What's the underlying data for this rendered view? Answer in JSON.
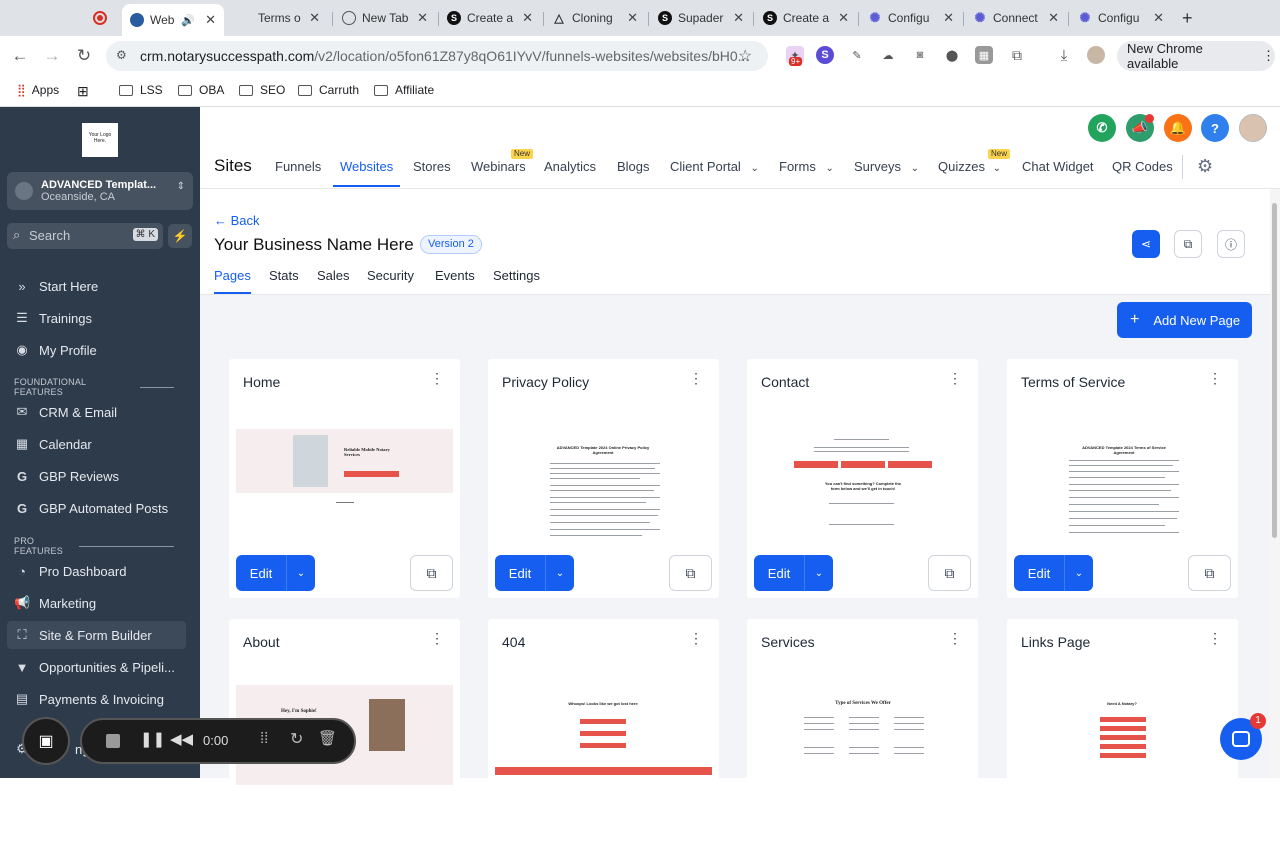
{
  "browser": {
    "tabs": [
      {
        "title": "Web",
        "active": true,
        "icon": "site-icon"
      },
      {
        "title": "Terms o",
        "icon": "page-icon"
      },
      {
        "title": "New Tab",
        "icon": "globe-icon"
      },
      {
        "title": "Create a",
        "icon": "s-icon"
      },
      {
        "title": "Cloning",
        "icon": "drive-icon"
      },
      {
        "title": "Supader",
        "icon": "s-icon"
      },
      {
        "title": "Create a",
        "icon": "s-icon"
      },
      {
        "title": "Configu",
        "icon": "star-icon"
      },
      {
        "title": "Connect",
        "icon": "star-icon"
      },
      {
        "title": "Configu",
        "icon": "star-icon"
      }
    ],
    "new_tab": "+",
    "url_domain": "crm.notarysuccesspath.com",
    "url_path": "/v2/location/o5fon61Z87y8qO61IYvV/funnels-websites/websites/bH0...",
    "ext_badge": "9+",
    "new_chrome": "New Chrome available",
    "bookmarks": [
      "Apps",
      "LSS",
      "OBA",
      "SEO",
      "Carruth",
      "Affiliate"
    ]
  },
  "sidebar": {
    "logo_text": "Your Logo Here.",
    "location_name": "ADVANCED Templat...",
    "location_city": "Oceanside, CA",
    "search_placeholder": "Search",
    "search_shortcut": "⌘ K",
    "items_top": [
      "Start Here",
      "Trainings",
      "My Profile"
    ],
    "section_foundational": "FOUNDATIONAL FEATURES",
    "items_foundational": [
      "CRM & Email",
      "Calendar",
      "GBP Reviews",
      "GBP Automated Posts"
    ],
    "section_pro": "PRO FEATURES",
    "items_pro": [
      "Pro Dashboard",
      "Marketing",
      "Site & Form Builder",
      "Opportunities & Pipeli...",
      "Payments & Invoicing"
    ],
    "settings_partial": "ngs"
  },
  "header": {
    "section_title": "Sites",
    "nav": [
      {
        "label": "Funnels"
      },
      {
        "label": "Websites",
        "active": true
      },
      {
        "label": "Stores"
      },
      {
        "label": "Webinars",
        "badge": "New"
      },
      {
        "label": "Analytics"
      },
      {
        "label": "Blogs"
      },
      {
        "label": "Client Portal",
        "dropdown": true
      },
      {
        "label": "Forms",
        "dropdown": true
      },
      {
        "label": "Surveys",
        "dropdown": true
      },
      {
        "label": "Quizzes",
        "dropdown": true,
        "badge": "New"
      },
      {
        "label": "Chat Widget"
      },
      {
        "label": "QR Codes"
      }
    ]
  },
  "page": {
    "back_label": "Back",
    "site_name": "Your Business Name Here",
    "version_badge": "Version 2",
    "tabs": [
      "Pages",
      "Stats",
      "Sales",
      "Security",
      "Events",
      "Settings"
    ],
    "add_page_label": "Add New Page",
    "edit_label": "Edit",
    "cards": [
      {
        "name": "Home",
        "thumb_heading": "Reliable Mobile Notary Services"
      },
      {
        "name": "Privacy Policy",
        "thumb_heading": "ADVANCED Template 2024 Online Privacy Policy Agreement"
      },
      {
        "name": "Contact",
        "thumb_heading": "You can't find something? Complete the form below and we'll get in touch!"
      },
      {
        "name": "Terms of Service",
        "thumb_heading": "ADVANCED Template 2024 Terms of Service Agreement"
      },
      {
        "name": "About",
        "thumb_heading": "Hey, I'm Sophie!"
      },
      {
        "name": "404",
        "thumb_heading": "Whoops! Looks like we got lost here"
      },
      {
        "name": "Services",
        "thumb_heading": "Type of Services We Offer"
      },
      {
        "name": "Links Page",
        "thumb_heading": "Need A Notary?"
      }
    ]
  },
  "recorder": {
    "time": "0:00"
  },
  "chat": {
    "badge": "1"
  },
  "colors": {
    "primary": "#155eef",
    "sidebar": "#2e3b4a",
    "accent_red": "#e5534b"
  }
}
